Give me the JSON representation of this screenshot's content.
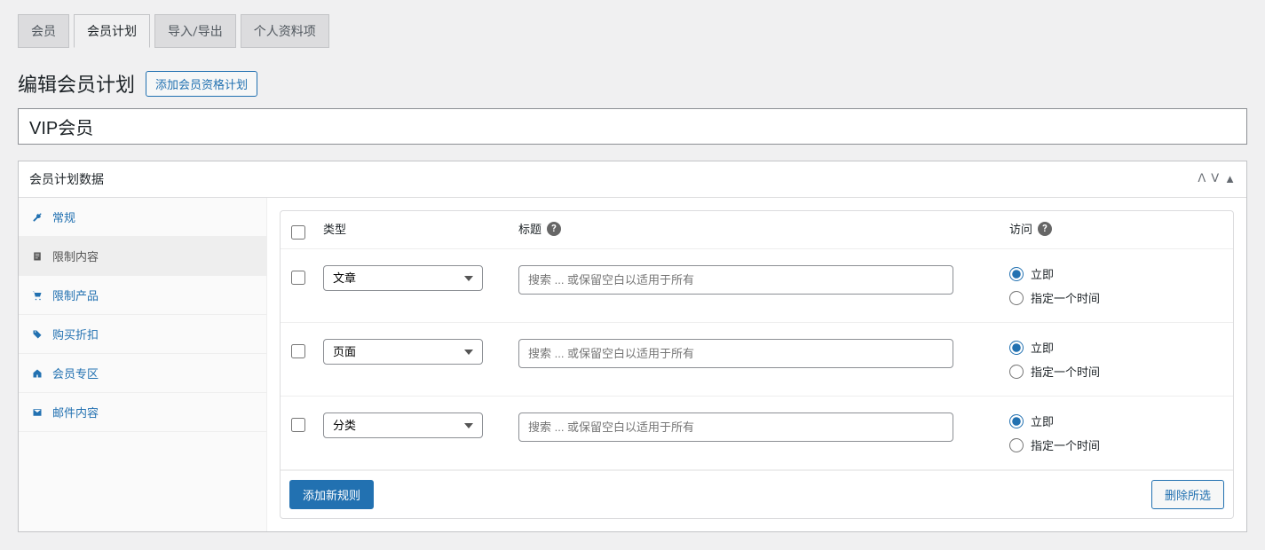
{
  "tabs": {
    "members": "会员",
    "plans": "会员计划",
    "import_export": "导入/导出",
    "profile_fields": "个人资料项",
    "active": "plans"
  },
  "header": {
    "title": "编辑会员计划",
    "action": "添加会员资格计划"
  },
  "title_input": {
    "value": "VIP会员"
  },
  "panel": {
    "title": "会员计划数据",
    "collapse_icons": {
      "up": "ᐱ",
      "down": "ᐯ",
      "toggle": "▲"
    }
  },
  "sidebar": {
    "items": [
      {
        "id": "general",
        "label": "常规",
        "icon": "wrench"
      },
      {
        "id": "restrict_content",
        "label": "限制内容",
        "icon": "note"
      },
      {
        "id": "restrict_products",
        "label": "限制产品",
        "icon": "cart"
      },
      {
        "id": "discounts",
        "label": "购买折扣",
        "icon": "tag"
      },
      {
        "id": "members_area",
        "label": "会员专区",
        "icon": "home"
      },
      {
        "id": "emails",
        "label": "邮件内容",
        "icon": "mail"
      }
    ],
    "active": "restrict_content"
  },
  "rules": {
    "columns": {
      "type": "类型",
      "title": "标题",
      "access": "访问"
    },
    "search_placeholder": "搜索 ... 或保留空白以适用于所有",
    "access_options": {
      "immediate": "立即",
      "specify": "指定一个时间"
    },
    "rows": [
      {
        "type": "文章",
        "access": "immediate"
      },
      {
        "type": "页面",
        "access": "immediate"
      },
      {
        "type": "分类",
        "access": "immediate"
      }
    ],
    "footer": {
      "add": "添加新规则",
      "delete": "删除所选"
    }
  }
}
